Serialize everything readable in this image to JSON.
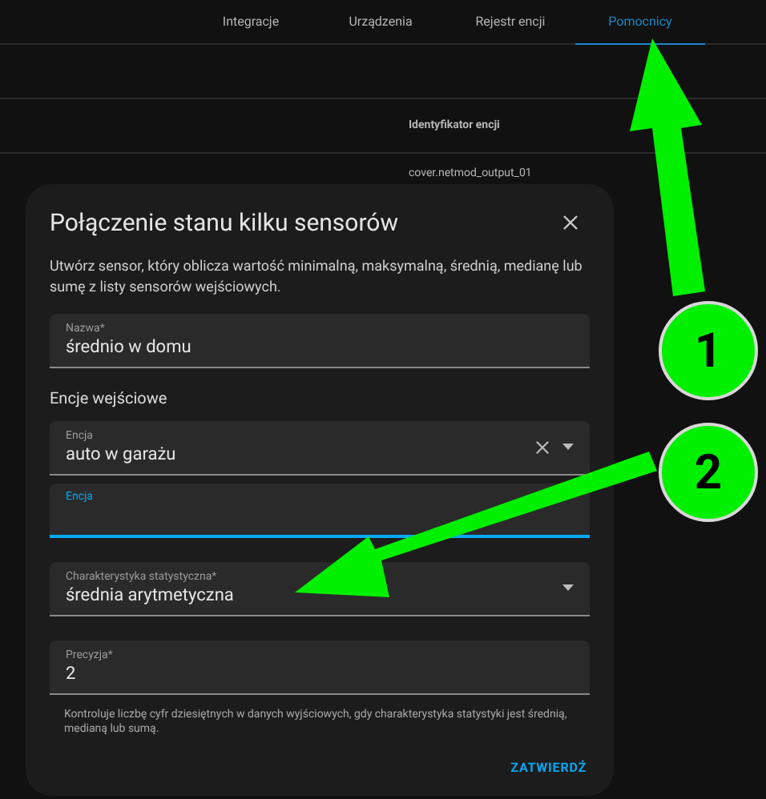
{
  "tabs": [
    {
      "label": "Integracje",
      "selected": false
    },
    {
      "label": "Urządzenia",
      "selected": false
    },
    {
      "label": "Rejestr encji",
      "selected": false
    },
    {
      "label": "Pomocnicy",
      "selected": true
    }
  ],
  "background_table": {
    "column_header": "Identyfikator encji",
    "rows": [
      "cover.netmod_output_01"
    ]
  },
  "dialog": {
    "title": "Połączenie stanu kilku sensorów",
    "description": "Utwórz sensor, który oblicza wartość minimalną, maksymalną, średnią, medianę lub sumę z listy sensorów wejściowych.",
    "form": [
      {
        "kind": "field",
        "label": "Nazwa*",
        "value": "średnio w domu",
        "focused": false,
        "clearable": false,
        "dropdown": false
      },
      {
        "kind": "heading",
        "text": "Encje wejściowe"
      },
      {
        "kind": "field",
        "label": "Encja",
        "value": "auto w garażu",
        "focused": false,
        "clearable": true,
        "dropdown": true
      },
      {
        "kind": "field",
        "label": "Encja",
        "focused": true,
        "clearable": false,
        "dropdown": false
      },
      {
        "kind": "field",
        "label": "Charakterystyka statystyczna*",
        "value": "średnia arytmetyczna",
        "focused": false,
        "clearable": false,
        "dropdown": true
      },
      {
        "kind": "field",
        "label": "Precyzja*",
        "value": "2",
        "focused": false,
        "clearable": false,
        "dropdown": false
      },
      {
        "kind": "helper",
        "text": "Kontroluje liczbę cyfr dziesiętnych w danych wyjściowych, gdy charakterystyka statystyki jest średnią, medianą lub sumą."
      }
    ],
    "submit": "ZATWIERDŹ"
  },
  "callouts": [
    "1",
    "2"
  ]
}
